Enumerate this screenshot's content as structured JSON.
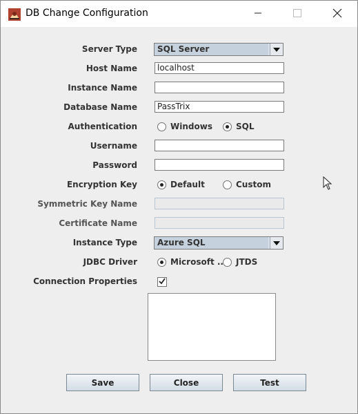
{
  "window": {
    "title": "DB Change Configuration",
    "app_icon": "java-app-icon",
    "controls": [
      "minimize-icon",
      "maximize-icon",
      "close-icon"
    ]
  },
  "form": {
    "server_type": {
      "label": "Server Type",
      "value": "SQL Server"
    },
    "host_name": {
      "label": "Host Name",
      "value": "localhost"
    },
    "instance_name": {
      "label": "Instance Name",
      "value": ""
    },
    "database_name": {
      "label": "Database Name",
      "value": "PassTrix"
    },
    "authentication": {
      "label": "Authentication",
      "options": [
        "Windows",
        "SQL"
      ],
      "selected": "SQL"
    },
    "username": {
      "label": "Username",
      "value": ""
    },
    "password": {
      "label": "Password",
      "value": ""
    },
    "encryption_key": {
      "label": "Encryption Key",
      "options": [
        "Default",
        "Custom"
      ],
      "selected": "Default"
    },
    "symmetric_key_name": {
      "label": "Symmetric Key Name",
      "value": "",
      "enabled": false
    },
    "certificate_name": {
      "label": "Certificate Name",
      "value": "",
      "enabled": false
    },
    "instance_type": {
      "label": "Instance Type",
      "value": "Azure SQL"
    },
    "jdbc_driver": {
      "label": "JDBC Driver",
      "options": [
        "Microsoft ...",
        "JTDS"
      ],
      "selected": "Microsoft ..."
    },
    "connection_properties": {
      "label": "Connection Properties",
      "checked": true,
      "text": ""
    }
  },
  "buttons": {
    "save": "Save",
    "close": "Close",
    "test": "Test"
  },
  "colors": {
    "window_bg": "#eeeeee",
    "combo_bg": "#c5d1dd",
    "button_top": "#f2f5f8",
    "button_bottom": "#d3dce5"
  }
}
